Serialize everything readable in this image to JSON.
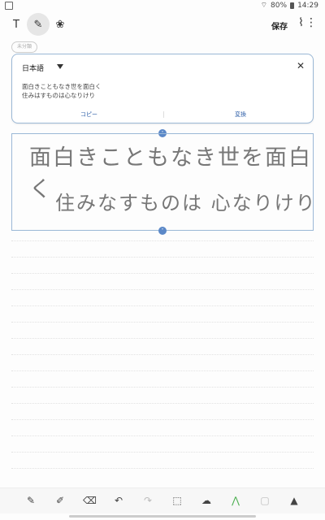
{
  "status": {
    "battery": "80%",
    "time": "14:29"
  },
  "toolbar": {
    "text_icon": "T",
    "pen_icon": "✎",
    "palette_icon": "❀",
    "save_label": "保存",
    "clip_icon": "⌇",
    "more_icon": "⋮"
  },
  "tag": "未分類",
  "conversion": {
    "language": "日本語",
    "close": "✕",
    "lines": [
      "面白きこともなき世を面白く",
      "住みはすものは心なりけり"
    ],
    "copy_label": "コピー",
    "convert_label": "変換"
  },
  "handwriting": [
    "面白きこともなき世を面白く",
    "住みなすものは 心なりけり"
  ],
  "handles": {
    "up": "˄",
    "down": "˅"
  },
  "bottom_tools": [
    "✎",
    "✐",
    "⌫",
    "↶",
    "↷",
    "⬚",
    "☁",
    "⋀",
    "▢",
    "▲"
  ]
}
